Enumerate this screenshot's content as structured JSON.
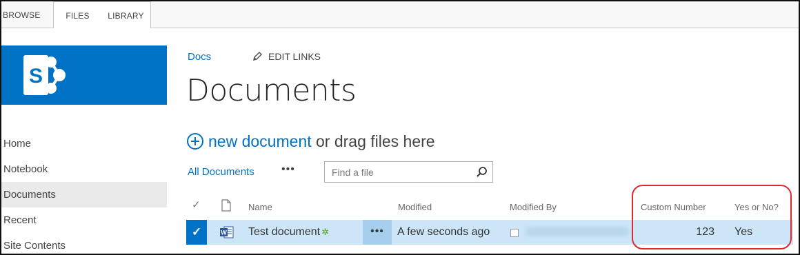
{
  "ribbon": {
    "tabs": [
      {
        "label": "BROWSE"
      },
      {
        "label": "FILES"
      },
      {
        "label": "LIBRARY"
      }
    ]
  },
  "site": {
    "logo_icon": "sharepoint-logo-icon",
    "brand_color": "#0072c6"
  },
  "quick_launch": {
    "items": [
      {
        "label": "Home"
      },
      {
        "label": "Notebook"
      },
      {
        "label": "Documents"
      },
      {
        "label": "Recent"
      },
      {
        "label": "Site Contents"
      }
    ]
  },
  "header": {
    "breadcrumb": "Docs",
    "edit_links": "EDIT LINKS",
    "page_title": "Documents"
  },
  "upload": {
    "link_text": "new document",
    "rest_text": " or drag files here"
  },
  "view": {
    "name": "All Documents",
    "more": "•••",
    "search_placeholder": "Find a file"
  },
  "table": {
    "columns": {
      "check": "✓",
      "name": "Name",
      "modified": "Modified",
      "modified_by": "Modified By",
      "custom_number": "Custom Number",
      "yes_or_no": "Yes or No?"
    },
    "rows": [
      {
        "name": "Test document",
        "new_badge": "✲",
        "ellipsis": "•••",
        "modified": "A few seconds ago",
        "custom_number": "123",
        "yes_or_no": "Yes"
      }
    ]
  },
  "colors": {
    "selected_row": "#cde6f7",
    "annotation": "#e0262f"
  }
}
